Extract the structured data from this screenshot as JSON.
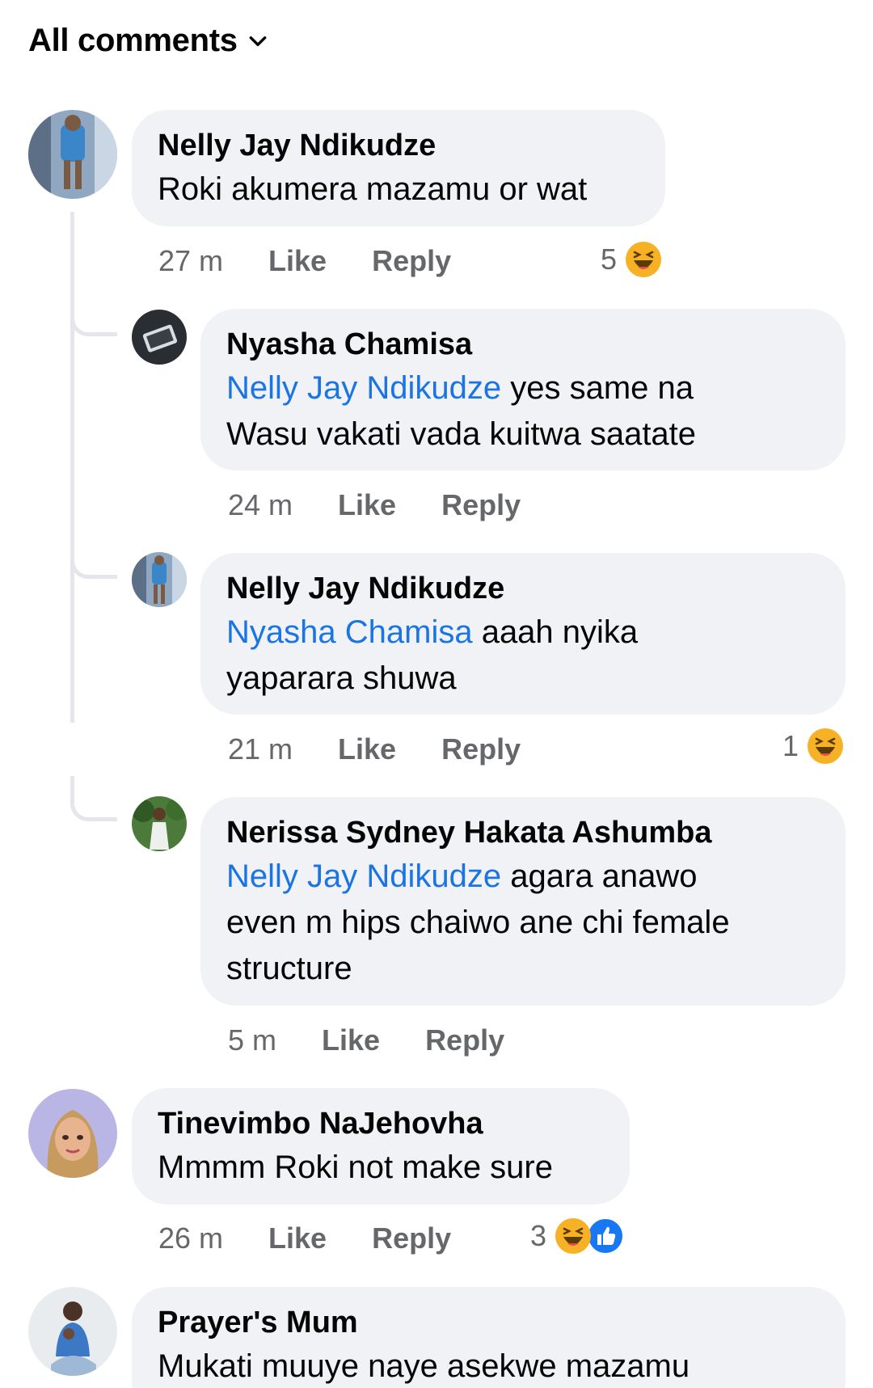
{
  "header": {
    "title": "All comments",
    "dropdown_icon": "chevron-down-icon"
  },
  "colors": {
    "bubble": "#f0f2f5",
    "mention": "#1b74e4",
    "meta": "#65676b",
    "haha": "#f7b125",
    "like": "#1877f2"
  },
  "comments": [
    {
      "author": "Nelly Jay Ndikudze",
      "text": "Roki akumera mazamu or wat",
      "time": "27 m",
      "like_label": "Like",
      "reply_label": "Reply",
      "reaction_count": "5",
      "reactions": [
        "haha-emoji-icon"
      ]
    },
    {
      "author": "Nyasha Chamisa",
      "mention": "Nelly Jay Ndikudze",
      "text_line1": " yes same na",
      "text_line2": "Wasu vakati vada kuitwa saatate",
      "time": "24 m",
      "like_label": "Like",
      "reply_label": "Reply"
    },
    {
      "author": "Nelly Jay Ndikudze",
      "mention": "Nyasha Chamisa",
      "text_line1": " aaah nyika",
      "text_line2": "yaparara shuwa",
      "time": "21 m",
      "like_label": "Like",
      "reply_label": "Reply",
      "reaction_count": "1",
      "reactions": [
        "haha-emoji-icon"
      ]
    },
    {
      "author": "Nerissa Sydney Hakata Ashumba",
      "mention": "Nelly Jay Ndikudze",
      "text_line1": " agara anawo",
      "text_line2": "even m hips chaiwo ane chi female",
      "text_line3": "structure",
      "time": "5 m",
      "like_label": "Like",
      "reply_label": "Reply"
    },
    {
      "author": "Tinevimbo NaJehovha",
      "text": "Mmmm Roki not make sure",
      "time": "26 m",
      "like_label": "Like",
      "reply_label": "Reply",
      "reaction_count": "3",
      "reactions": [
        "haha-emoji-icon",
        "like-thumb-icon"
      ]
    },
    {
      "author": "Prayer's Mum",
      "text": "Mukati muuye naye asekwe mazamu"
    }
  ]
}
